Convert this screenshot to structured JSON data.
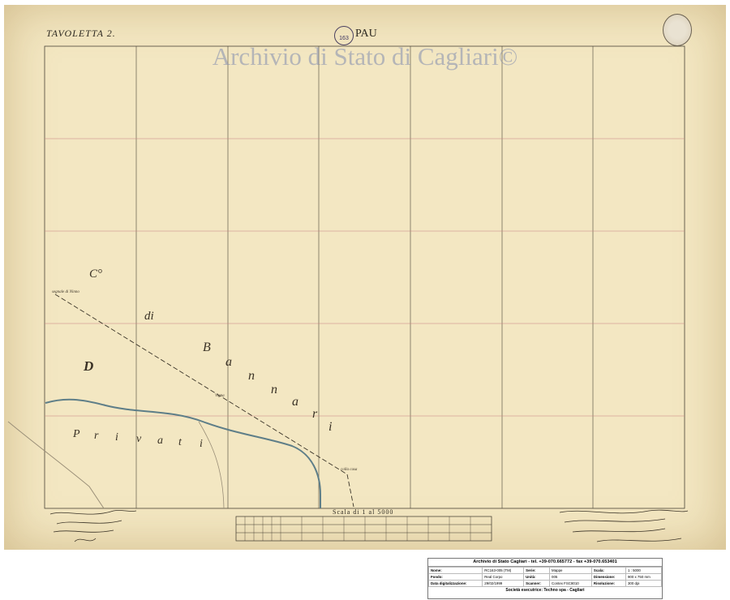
{
  "sheet": {
    "tavoletta": "TAVOLETTA 2.",
    "sheet_label": "PAU",
    "stamp_text": "163",
    "watermark": "Archivio di Stato di Cagliari©",
    "seal_icon": "archive-seal-icon"
  },
  "map_labels": {
    "co": "C°",
    "di": "di",
    "bannari": [
      "B",
      "a",
      "n",
      "n",
      "a",
      "r",
      "i"
    ],
    "D": "D",
    "privati": [
      "P",
      "r",
      "i",
      "v",
      "a",
      "t",
      "i"
    ]
  },
  "scale": {
    "title": "Scala di 1 al 5000"
  },
  "info_box": {
    "header": "Archivio di Stato Cagliari - tel. +39-070.665772 - fax +39-070.653401",
    "rows": [
      {
        "k1": "Nome:",
        "v1": "RC163-005 (TM)",
        "k2": "Serie:",
        "v2": "Mappe",
        "k3": "Scala:",
        "v3": "1 : 5000"
      },
      {
        "k1": "Fondo:",
        "v1": "Real Corpo",
        "k2": "Unità:",
        "v2": "005",
        "k3": "Dimensione:",
        "v3": "900 x 750 mm"
      },
      {
        "k1": "Data digitalizzazione:",
        "v1": "29/02/1999",
        "k2": "Scanner:",
        "v2": "Contex FSC8010",
        "k3": "Risoluzione:",
        "v3": "300 dpi"
      }
    ],
    "footer": "Società esecutrice: Techno spa - Cagliari"
  },
  "colors": {
    "paper": "#f3e7c2",
    "grid_black": "#4a4438",
    "grid_red": "#c98080",
    "river": "#5e7e88"
  }
}
